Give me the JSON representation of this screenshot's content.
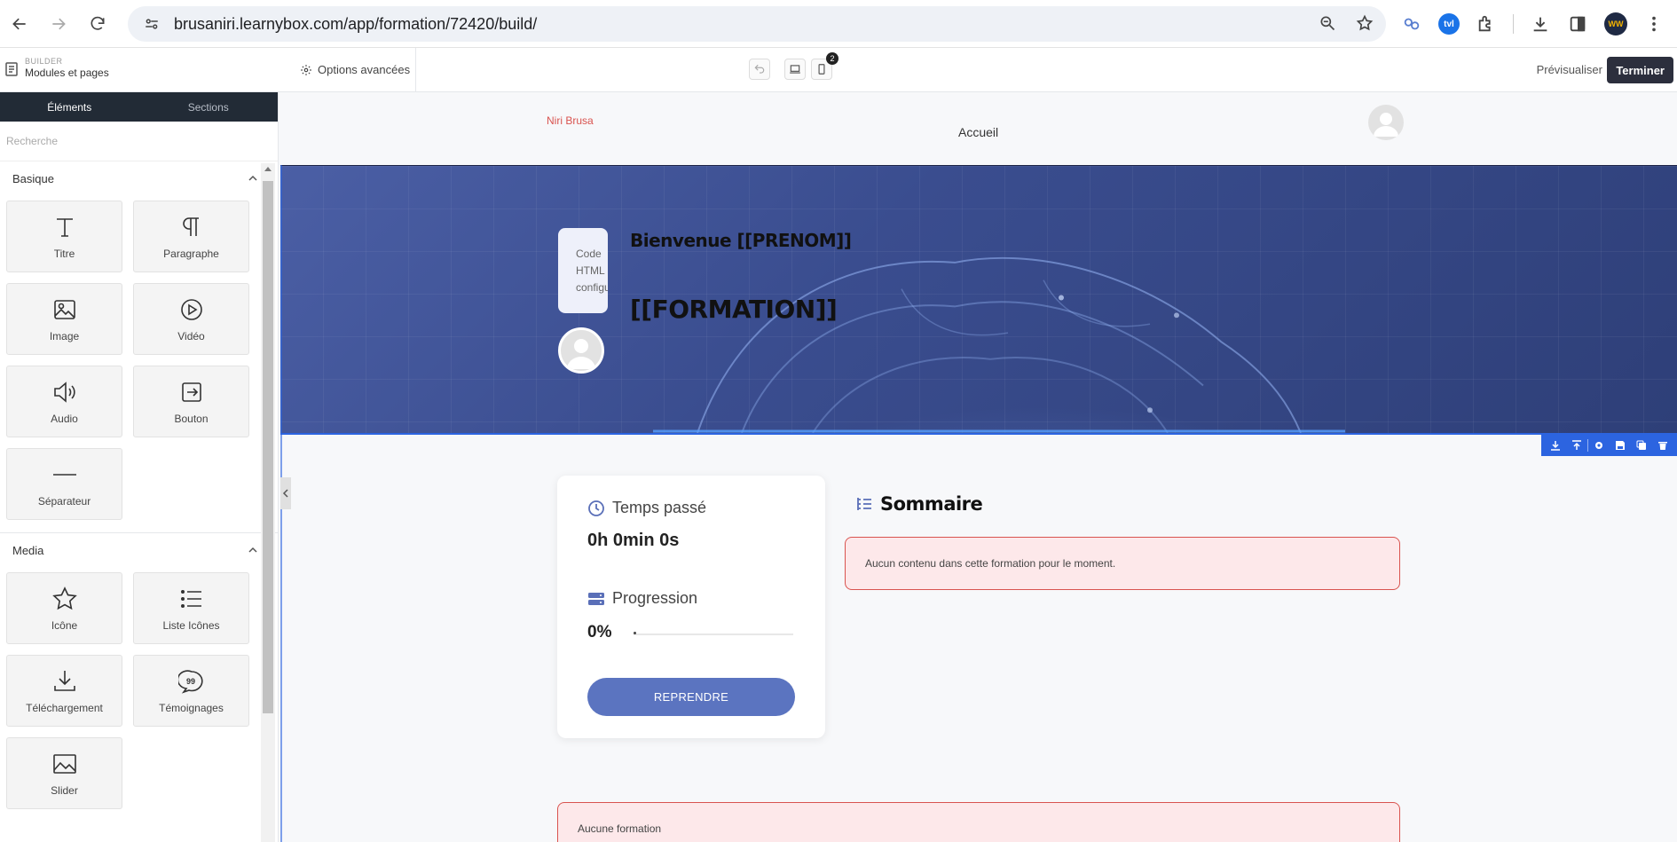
{
  "browser": {
    "url": "brusaniri.learnybox.com/app/formation/72420/build/",
    "ext_badge_text": "tvl",
    "profile_text": "WW"
  },
  "builder": {
    "breadcrumb_sub": "BUILDER",
    "breadcrumb_main": "Modules et pages",
    "advanced_options": "Options avancées",
    "device_count": "2",
    "preview_label": "Prévisualiser",
    "finish_label": "Terminer"
  },
  "sidebar": {
    "tabs": [
      {
        "label": "Éléments",
        "active": true
      },
      {
        "label": "Sections",
        "active": false
      }
    ],
    "search_placeholder": "Recherche",
    "categories": [
      {
        "title": "Basique",
        "items": [
          {
            "label": "Titre",
            "icon": "title-icon"
          },
          {
            "label": "Paragraphe",
            "icon": "paragraph-icon"
          },
          {
            "label": "Image",
            "icon": "image-icon"
          },
          {
            "label": "Vidéo",
            "icon": "video-icon"
          },
          {
            "label": "Audio",
            "icon": "audio-icon"
          },
          {
            "label": "Bouton",
            "icon": "button-icon"
          },
          {
            "label": "Séparateur",
            "icon": "separator-icon"
          }
        ]
      },
      {
        "title": "Media",
        "items": [
          {
            "label": "Icône",
            "icon": "star-icon"
          },
          {
            "label": "Liste Icônes",
            "icon": "list-icon"
          },
          {
            "label": "Téléchargement",
            "icon": "download-icon"
          },
          {
            "label": "Témoignages",
            "icon": "quote-bubble-icon"
          },
          {
            "label": "Slider",
            "icon": "slider-icon"
          }
        ]
      }
    ]
  },
  "canvas": {
    "site_brand": "Niri Brusa",
    "site_nav": "Accueil",
    "hero": {
      "code_lines": [
        "Code",
        "HTML",
        "configu"
      ],
      "greeting": "Bienvenue [[PRENOM]]",
      "title": "[[FORMATION]]"
    },
    "stats": {
      "time_label": "Temps passé",
      "time_value": "0h 0min 0s",
      "progress_label": "Progression",
      "progress_value": "0%",
      "progress_fraction": 0,
      "resume_label": "REPRENDRE"
    },
    "summary": {
      "title": "Sommaire",
      "empty_message": "Aucun contenu dans cette formation pour le moment."
    },
    "no_formation_message": "Aucune formation"
  },
  "colors": {
    "accent": "#5b74c0",
    "hero_bg": "#3a4d8f",
    "alert_bg": "#fde8ea",
    "alert_border": "#d9534f",
    "dark_tab": "#222b36",
    "selection": "#2c64e0"
  }
}
